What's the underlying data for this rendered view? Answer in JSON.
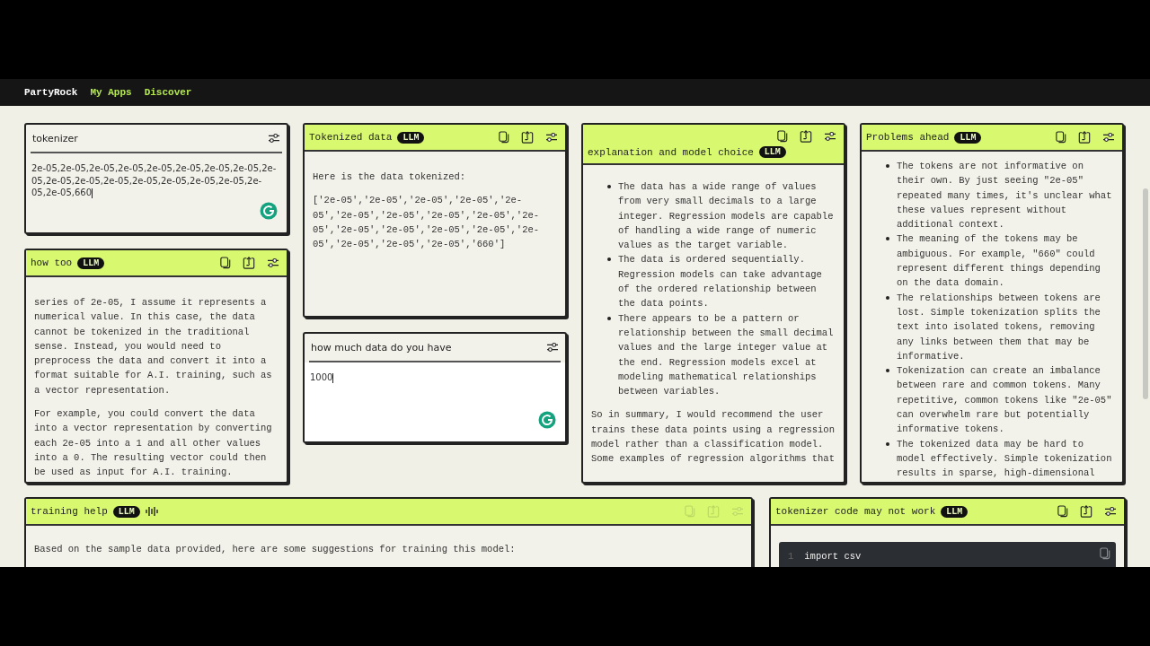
{
  "nav": {
    "brand": "PartyRock",
    "links": [
      {
        "label": "My Apps"
      },
      {
        "label": "Discover"
      }
    ]
  },
  "columns": [
    [
      {
        "kind": "input",
        "title": "tokenizer",
        "value": "2e-05,2e-05,2e-05,2e-05,2e-05,2e-05,2e-05,2e-05,2e-05,2e-05,2e-05,2e-05,2e-05,2e-05,2e-05,2e-05,2e-05,2e-05,660",
        "assistant": true
      },
      {
        "kind": "llm",
        "title": "how too",
        "badge": "LLM",
        "busy": false,
        "blocks": [
          {
            "kind": "paragraph",
            "text": "series of 2e-05, I assume it represents a numerical value. In this case, the data cannot be tokenized in the traditional sense. Instead, you would need to preprocess the data and convert it into a format suitable for A.I. training, such as a vector representation."
          },
          {
            "kind": "paragraph",
            "text": "For example, you could convert the data into a vector representation by converting each 2e-05 into a 1 and all other values into a 0. The resulting vector could then be used as input for A.I. training."
          }
        ]
      }
    ],
    [
      {
        "kind": "llm",
        "title": "Tokenized data",
        "badge": "LLM",
        "busy": false,
        "blocks": [
          {
            "kind": "paragraph",
            "text": "Here is the data tokenized:"
          },
          {
            "kind": "paragraph",
            "text": "['2e-05','2e-05','2e-05','2e-05','2e-05','2e-05','2e-05','2e-05','2e-05','2e-05','2e-05','2e-05','2e-05','2e-05','2e-05','2e-05','2e-05','2e-05','660']"
          }
        ]
      },
      {
        "kind": "input",
        "title": "how much data do you have",
        "value": "1000",
        "assistant": true
      }
    ],
    [
      {
        "kind": "llm",
        "title": "explanation and model choice",
        "badge": "LLM",
        "busy": false,
        "blocks": [
          {
            "kind": "bullets",
            "items": [
              "The data has a wide range of values from very small decimals to a large integer. Regression models are capable of handling a wide range of numeric values as the target variable.",
              "The data is ordered sequentially. Regression models can take advantage of the ordered relationship between the data points.",
              "There appears to be a pattern or relationship between the small decimal values and the large integer value at the end. Regression models excel at modeling mathematical relationships between variables."
            ]
          },
          {
            "kind": "paragraph",
            "text": "So in summary, I would recommend the user trains these data points using a regression model rather than a classification model. Some examples of regression algorithms that"
          }
        ]
      }
    ],
    [
      {
        "kind": "llm",
        "title": "Problems ahead",
        "badge": "LLM",
        "busy": false,
        "blocks": [
          {
            "kind": "bullets",
            "items": [
              "The tokens are not informative on their own. By just seeing \"2e-05\" repeated many times, it's unclear what these values represent without additional context.",
              "The meaning of the tokens may be ambiguous. For example, \"660\" could represent different things depending on the data domain.",
              "The relationships between tokens are lost. Simple tokenization splits the text into isolated tokens, removing any links between them that may be informative.",
              "Tokenization can create an imbalance between rare and common tokens. Many repetitive, common tokens like \"2e-05\" can overwhelm rare but potentially informative tokens.",
              "The tokenized data may be hard to model effectively. Simple tokenization results in sparse, high-dimensional"
            ]
          }
        ]
      }
    ]
  ],
  "bottom": [
    {
      "kind": "llm",
      "title": "training help",
      "badge": "LLM",
      "busy": true,
      "blocks": [
        {
          "kind": "paragraph",
          "text": "Based on the sample data provided, here are some suggestions for training this model:"
        }
      ]
    },
    {
      "kind": "llm",
      "title": "tokenizer code may not work",
      "badge": "LLM",
      "busy": false,
      "blocks": [
        {
          "kind": "code",
          "lines": [
            {
              "number": "1",
              "text": "import csv"
            }
          ]
        }
      ]
    }
  ]
}
